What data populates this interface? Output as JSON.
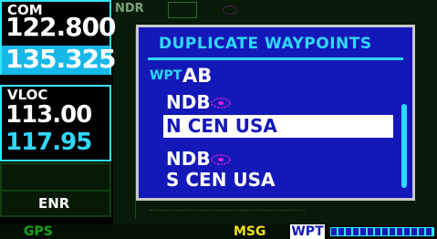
{
  "com": {
    "label": "COM",
    "active": "122.800",
    "standby": "135.325"
  },
  "vloc": {
    "label": "VLOC",
    "active": "113.00",
    "standby": "117.95"
  },
  "mode": "ENR",
  "background": {
    "header": "NDR"
  },
  "dialog": {
    "title": "DUPLICATE WAYPOINTS",
    "wpt_label": "WPT",
    "wpt_value": "AB",
    "items": [
      {
        "type": "NDB",
        "icon": "ndb-icon",
        "region": "N CEN USA",
        "selected": true
      },
      {
        "type": "NDB",
        "icon": "ndb-icon",
        "region": "S CEN USA",
        "selected": false
      }
    ]
  },
  "status_bar": {
    "left": "GPS",
    "msg": "MSG",
    "page": "WPT"
  },
  "colors": {
    "cyan": "#30d8ff",
    "dialog_bg": "#1418b8",
    "green": "#0a3a0a",
    "yellow": "#f0e020"
  }
}
